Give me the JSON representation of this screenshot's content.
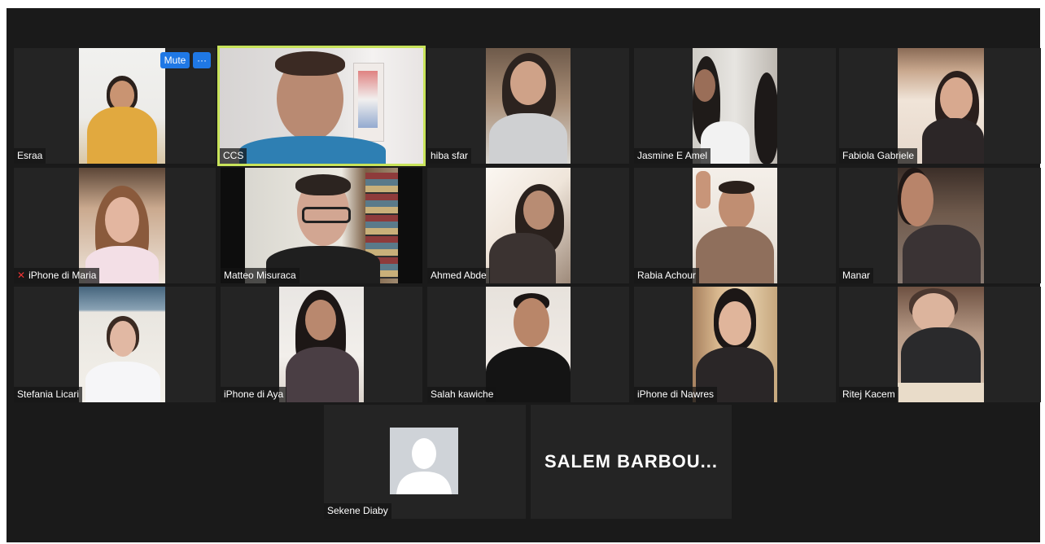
{
  "meeting": {
    "controls": {
      "mute_label": "Mute",
      "more_label": "···"
    },
    "participants": [
      {
        "name": "Esraa"
      },
      {
        "name": "CCS"
      },
      {
        "name": "hiba sfar"
      },
      {
        "name": "Jasmine E Amel"
      },
      {
        "name": "Fabiola Gabriele"
      },
      {
        "name": "iPhone di Maria",
        "muted": true
      },
      {
        "name": "Matteo Misuraca"
      },
      {
        "name": "Ahmed Abde"
      },
      {
        "name": "Rabia Achour"
      },
      {
        "name": "Manar"
      },
      {
        "name": "Stefania Licari"
      },
      {
        "name": "iPhone di Aya"
      },
      {
        "name": "Salah kawiche"
      },
      {
        "name": "iPhone di Nawres"
      },
      {
        "name": "Ritej Kacem"
      },
      {
        "name": "Sekene Diaby",
        "no_video": true
      },
      {
        "name": "SALEM  BARBOU...",
        "video_off": true
      }
    ]
  },
  "colors": {
    "active_speaker_border": "#c8e35a",
    "button_blue": "#1f78e5",
    "muted_red": "#e33"
  }
}
